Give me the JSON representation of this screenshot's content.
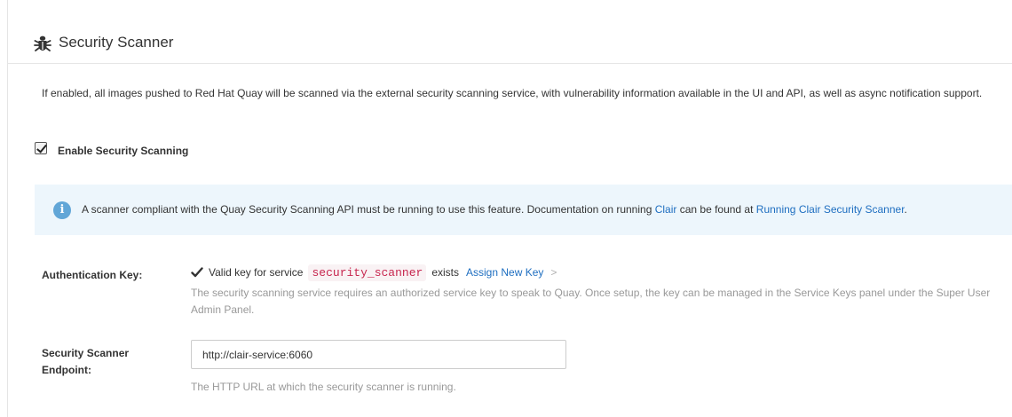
{
  "section": {
    "title": "Security Scanner",
    "icon": "bug-icon",
    "description": "If enabled, all images pushed to Red Hat Quay will be scanned via the external security scanning service, with vulnerability information available in the UI and API, as well as async notification support."
  },
  "enable": {
    "label": "Enable Security Scanning",
    "checked": true
  },
  "info": {
    "icon": "info-icon",
    "text_before": "A scanner compliant with the Quay Security Scanning API must be running to use this feature. Documentation on running ",
    "link1": "Clair",
    "text_middle": " can be found at ",
    "link2": "Running Clair Security Scanner",
    "text_after": "."
  },
  "auth": {
    "label": "Authentication Key:",
    "status_before": "Valid key for service",
    "service_name": "security_scanner",
    "status_after": "exists",
    "assign_label": "Assign New Key",
    "chevron": ">",
    "help": "The security scanning service requires an authorized service key to speak to Quay. Once setup, the key can be managed in the Service Keys panel under the Super User Admin Panel."
  },
  "endpoint": {
    "label": "Security Scanner Endpoint:",
    "value": "http://clair-service:6060",
    "help": "The HTTP URL at which the security scanner is running."
  },
  "colors": {
    "link": "#1e6ec0",
    "info_bg": "#edf6fc",
    "info_icon": "#61a6d7",
    "code_text": "#c7254e",
    "help_text": "#999999"
  }
}
